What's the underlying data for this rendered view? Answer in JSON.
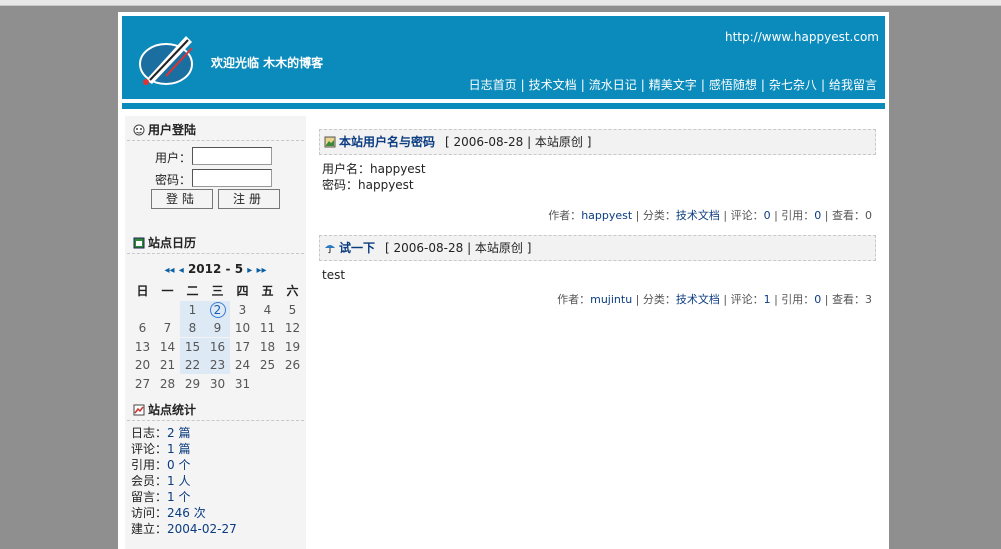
{
  "header": {
    "welcome": "欢迎光临  木木的博客",
    "url": "http://www.happyest.com",
    "nav": [
      "日志首页",
      "技术文档",
      "流水日记",
      "精美文字",
      "感悟随想",
      "杂七杂八",
      "给我留言"
    ]
  },
  "login": {
    "title": "用户登陆",
    "user_label": "用户：",
    "pass_label": "密码：",
    "login_btn": "登陆",
    "register_btn": "注册"
  },
  "calendar": {
    "title": "站点日历",
    "month_label": "2012 - 5",
    "prev_year": "◂◂",
    "prev_month": "◂",
    "next_month": "▸",
    "next_year": "▸▸",
    "weekdays": [
      "日",
      "一",
      "二",
      "三",
      "四",
      "五",
      "六"
    ],
    "weeks": [
      [
        "",
        "",
        "1",
        "2",
        "3",
        "4",
        "5"
      ],
      [
        "6",
        "7",
        "8",
        "9",
        "10",
        "11",
        "12"
      ],
      [
        "13",
        "14",
        "15",
        "16",
        "17",
        "18",
        "19"
      ],
      [
        "20",
        "21",
        "22",
        "23",
        "24",
        "25",
        "26"
      ],
      [
        "27",
        "28",
        "29",
        "30",
        "31",
        "",
        ""
      ]
    ],
    "today": "2",
    "highlighted": [
      "1",
      "2",
      "8",
      "9",
      "15",
      "16",
      "22",
      "23"
    ]
  },
  "stats": {
    "title": "站点统计",
    "items": [
      {
        "label": "日志：",
        "value": "2 篇"
      },
      {
        "label": "评论：",
        "value": "1 篇"
      },
      {
        "label": "引用：",
        "value": "0 个"
      },
      {
        "label": "会员：",
        "value": "1 人"
      },
      {
        "label": "留言：",
        "value": "1 个"
      },
      {
        "label": "访问：",
        "value": "246 次"
      },
      {
        "label": "建立：",
        "value": "2004-02-27"
      }
    ]
  },
  "posts": [
    {
      "title": "本站用户名与密码",
      "date": "[ 2006-08-28  |  本站原创  ]",
      "body": [
        "用户名：happyest",
        "密码：happyest"
      ],
      "author": "happyest",
      "category": "技术文档",
      "comments": "0",
      "trackbacks": "0",
      "views": "0"
    },
    {
      "title": "试一下",
      "date": "[ 2006-08-28  |  本站原创  ]",
      "body": [
        "test"
      ],
      "author": "mujintu",
      "category": "技术文档",
      "comments": "1",
      "trackbacks": "0",
      "views": "3"
    }
  ],
  "labels": {
    "author": "作者：",
    "category": "分类：",
    "comments": "评论：",
    "trackbacks": "引用：",
    "views": "查看："
  },
  "colors": {
    "brand": "#0b8bbb",
    "link": "#0b3c80"
  }
}
